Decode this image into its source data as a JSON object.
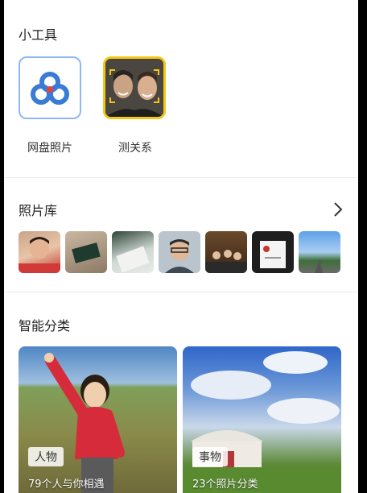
{
  "tools": {
    "title": "小工具",
    "items": [
      {
        "label": "网盘照片",
        "icon": "cloud-icon"
      },
      {
        "label": "测关系",
        "icon": "face-relation-icon"
      }
    ]
  },
  "photo_library": {
    "title": "照片库",
    "chevron": "chevron-right-icon",
    "thumbnails": [
      "child-photo",
      "card-photo",
      "object-photo",
      "man-photo",
      "meeting-photo",
      "screen-photo",
      "road-photo"
    ]
  },
  "smart_category": {
    "title": "智能分类",
    "cards": [
      {
        "tag": "人物",
        "subtitle": "79个人与你相遇"
      },
      {
        "tag": "事物",
        "subtitle": "23个照片分类"
      }
    ]
  },
  "colors": {
    "accent_blue": "#3a7bd5",
    "cloud_red": "#e8433a",
    "highlight_yellow": "#f5c518"
  }
}
